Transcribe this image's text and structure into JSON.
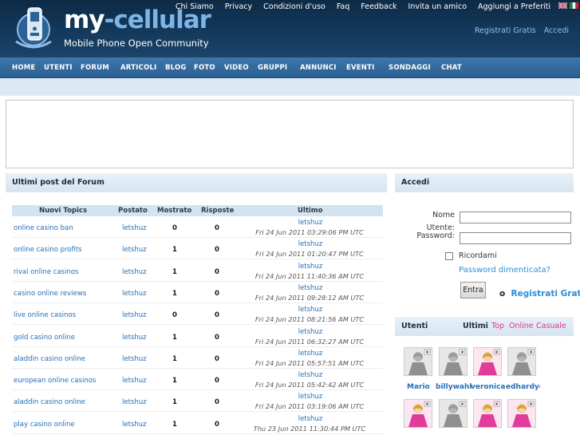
{
  "brand": {
    "title_part1": "my",
    "title_part2": "-cellular",
    "subtitle": "Mobile Phone Open Community"
  },
  "top_links": [
    "Chi Siamo",
    "Privacy",
    "Condizioni d'uso",
    "Faq",
    "Feedback",
    "Invita un amico",
    "Aggiungi a Preferiti"
  ],
  "account_links": {
    "register": "Registrati Gratis",
    "login": "Accedi"
  },
  "main_nav": [
    "HOME",
    "UTENTI",
    "FORUM",
    "ARTICOLI",
    "BLOG",
    "FOTO",
    "VIDEO",
    "GRUPPI",
    "ANNUNCI",
    "EVENTI",
    "SONDAGGI",
    "CHAT"
  ],
  "forum": {
    "heading": "Ultimi post del Forum",
    "columns": [
      "Nuovi Topics",
      "Postato",
      "Mostrato",
      "Risposte",
      "Ultimo"
    ],
    "rows": [
      {
        "topic": "online casino ban",
        "posted_by": "letshuz",
        "views": "0",
        "replies": "0",
        "last_user": "letshuz",
        "last_date": "Fri 24 Jun 2011 03:29:06 PM UTC"
      },
      {
        "topic": "online casino profits",
        "posted_by": "letshuz",
        "views": "1",
        "replies": "0",
        "last_user": "letshuz",
        "last_date": "Fri 24 Jun 2011 01:20:47 PM UTC"
      },
      {
        "topic": "rival online casinos",
        "posted_by": "letshuz",
        "views": "1",
        "replies": "0",
        "last_user": "letshuz",
        "last_date": "Fri 24 Jun 2011 11:40:36 AM UTC"
      },
      {
        "topic": "casino online reviews",
        "posted_by": "letshuz",
        "views": "1",
        "replies": "0",
        "last_user": "letshuz",
        "last_date": "Fri 24 Jun 2011 09:28:12 AM UTC"
      },
      {
        "topic": "live online casinos",
        "posted_by": "letshuz",
        "views": "0",
        "replies": "0",
        "last_user": "letshuz",
        "last_date": "Fri 24 Jun 2011 08:21:56 AM UTC"
      },
      {
        "topic": "gold casino online",
        "posted_by": "letshuz",
        "views": "1",
        "replies": "0",
        "last_user": "letshuz",
        "last_date": "Fri 24 Jun 2011 06:32:27 AM UTC"
      },
      {
        "topic": "aladdin casino online",
        "posted_by": "letshuz",
        "views": "1",
        "replies": "0",
        "last_user": "letshuz",
        "last_date": "Fri 24 Jun 2011 05:57:51 AM UTC"
      },
      {
        "topic": "european online casinos",
        "posted_by": "letshuz",
        "views": "1",
        "replies": "0",
        "last_user": "letshuz",
        "last_date": "Fri 24 Jun 2011 05:42:42 AM UTC"
      },
      {
        "topic": "aladdin casino online",
        "posted_by": "letshuz",
        "views": "1",
        "replies": "0",
        "last_user": "letshuz",
        "last_date": "Fri 24 Jun 2011 03:19:06 AM UTC"
      },
      {
        "topic": "play casino online",
        "posted_by": "letshuz",
        "views": "1",
        "replies": "0",
        "last_user": "letshuz",
        "last_date": "Thu 23 Jun 2011 11:30:44 PM UTC"
      }
    ]
  },
  "login": {
    "heading": "Accedi",
    "name_label": "Nome",
    "user_label": "Utente:",
    "password_label": "Password:",
    "remember_label": "Ricordami",
    "forgot_link": "Password dimenticata?",
    "submit_label": "Entra",
    "or_label": "o",
    "register_link": "Registrati Grat"
  },
  "users": {
    "heading": "Utenti",
    "tabs": [
      "Ultimi",
      "Top",
      "Online",
      "Casuale"
    ],
    "names": [
      "Mario",
      "billywahl",
      "veronica",
      "edhardyc"
    ],
    "avatars_row1": [
      "male",
      "male",
      "female",
      "male"
    ],
    "avatars_row2": [
      "female",
      "male",
      "female",
      "female"
    ]
  },
  "colors": {
    "header_bg": "#14395c",
    "nav_bg": "#2b5f91",
    "link": "#2370b8",
    "accent_pink": "#e0348f"
  }
}
